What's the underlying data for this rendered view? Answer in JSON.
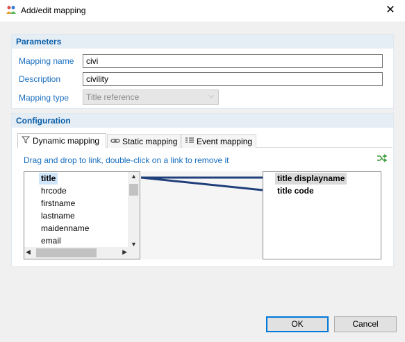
{
  "window": {
    "title": "Add/edit mapping",
    "close_glyph": "✕",
    "icon": "users-icon"
  },
  "parameters": {
    "header": "Parameters",
    "mapping_name_label": "Mapping name",
    "mapping_name_value": "civi",
    "description_label": "Description",
    "description_value": "civility",
    "mapping_type_label": "Mapping type",
    "mapping_type_value": "Title reference"
  },
  "configuration": {
    "header": "Configuration",
    "tabs": [
      {
        "label": "Dynamic mapping",
        "icon": "funnel-icon",
        "active": true
      },
      {
        "label": "Static mapping",
        "icon": "link-icon",
        "active": false
      },
      {
        "label": "Event mapping",
        "icon": "list-icon",
        "active": false
      }
    ],
    "hint": "Drag and drop to link, double-click on a link to remove it",
    "source_fields": [
      "title",
      "hrcode",
      "firstname",
      "lastname",
      "maidenname",
      "email"
    ],
    "target_fields": [
      "title displayname",
      "title code"
    ],
    "links": [
      {
        "from": "title",
        "to": "title displayname"
      },
      {
        "from": "title",
        "to": "title code"
      }
    ],
    "link_color": "#1f3f7a"
  },
  "buttons": {
    "ok": "OK",
    "cancel": "Cancel"
  }
}
